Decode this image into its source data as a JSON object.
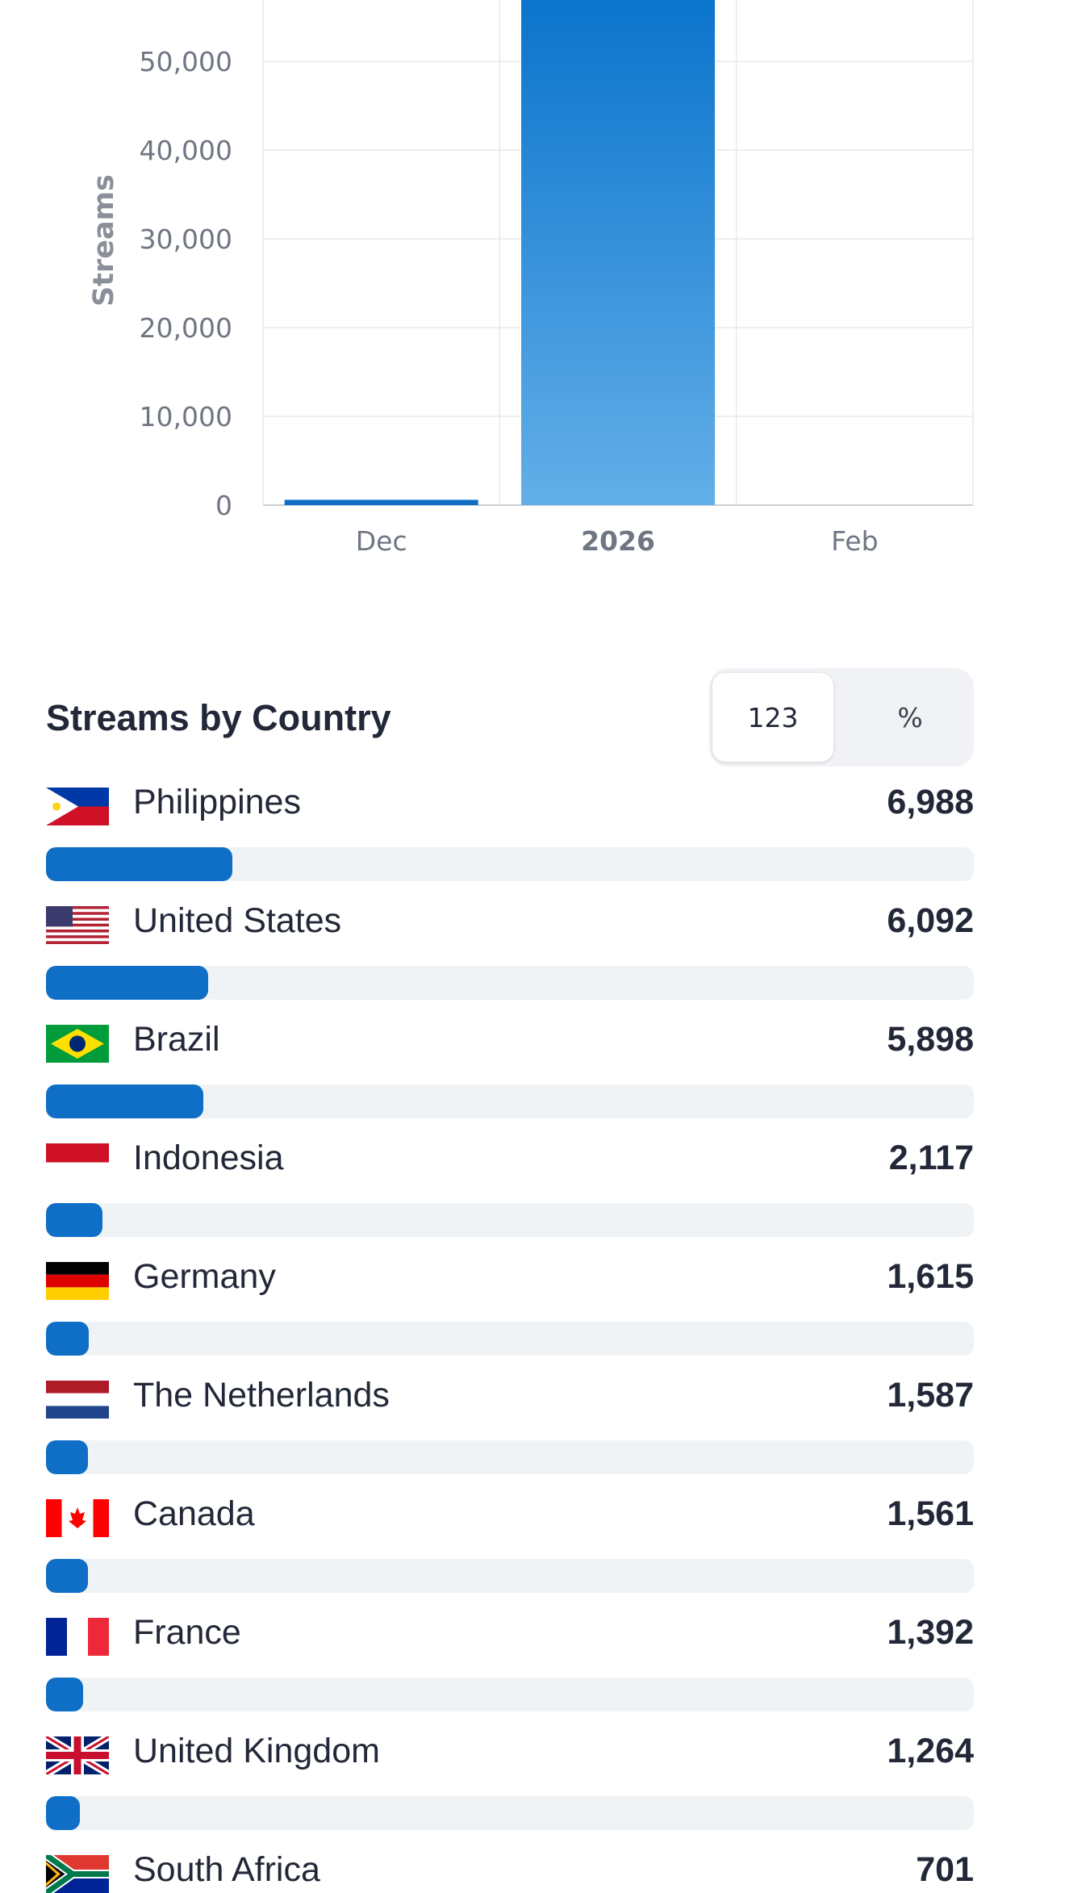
{
  "chart_data": {
    "type": "bar",
    "categories": [
      "Dec",
      "2026",
      "Feb"
    ],
    "values": [
      600,
      57000,
      0
    ],
    "highlighted_category": "2026",
    "ylabel": "Streams",
    "y_ticks": [
      "0",
      "10,000",
      "20,000",
      "30,000",
      "40,000",
      "50,000"
    ],
    "ylim": [
      0,
      57000
    ],
    "grid": true,
    "bar_color_top": "#0b74cc",
    "bar_color_bottom": "#63afe8"
  },
  "country_section": {
    "title": "Streams by Country",
    "toggle": {
      "count_label": "123",
      "percent_label": "%",
      "selected": "123"
    },
    "scale_max": 34800,
    "countries": [
      {
        "name": "Philippines",
        "value": "6,988",
        "streams": 6988,
        "flag": "flag-ph-icon"
      },
      {
        "name": "United States",
        "value": "6,092",
        "streams": 6092,
        "flag": "flag-us-icon"
      },
      {
        "name": "Brazil",
        "value": "5,898",
        "streams": 5898,
        "flag": "flag-br-icon"
      },
      {
        "name": "Indonesia",
        "value": "2,117",
        "streams": 2117,
        "flag": "flag-id-icon"
      },
      {
        "name": "Germany",
        "value": "1,615",
        "streams": 1615,
        "flag": "flag-de-icon"
      },
      {
        "name": "The Netherlands",
        "value": "1,587",
        "streams": 1587,
        "flag": "flag-nl-icon"
      },
      {
        "name": "Canada",
        "value": "1,561",
        "streams": 1561,
        "flag": "flag-ca-icon"
      },
      {
        "name": "France",
        "value": "1,392",
        "streams": 1392,
        "flag": "flag-fr-icon"
      },
      {
        "name": "United Kingdom",
        "value": "1,264",
        "streams": 1264,
        "flag": "flag-gb-icon"
      },
      {
        "name": "South Africa",
        "value": "701",
        "streams": 701,
        "flag": "flag-za-icon"
      }
    ]
  },
  "colors": {
    "accent": "#0f6fc6",
    "bar_track": "#f0f3f5",
    "text": "#232838"
  }
}
